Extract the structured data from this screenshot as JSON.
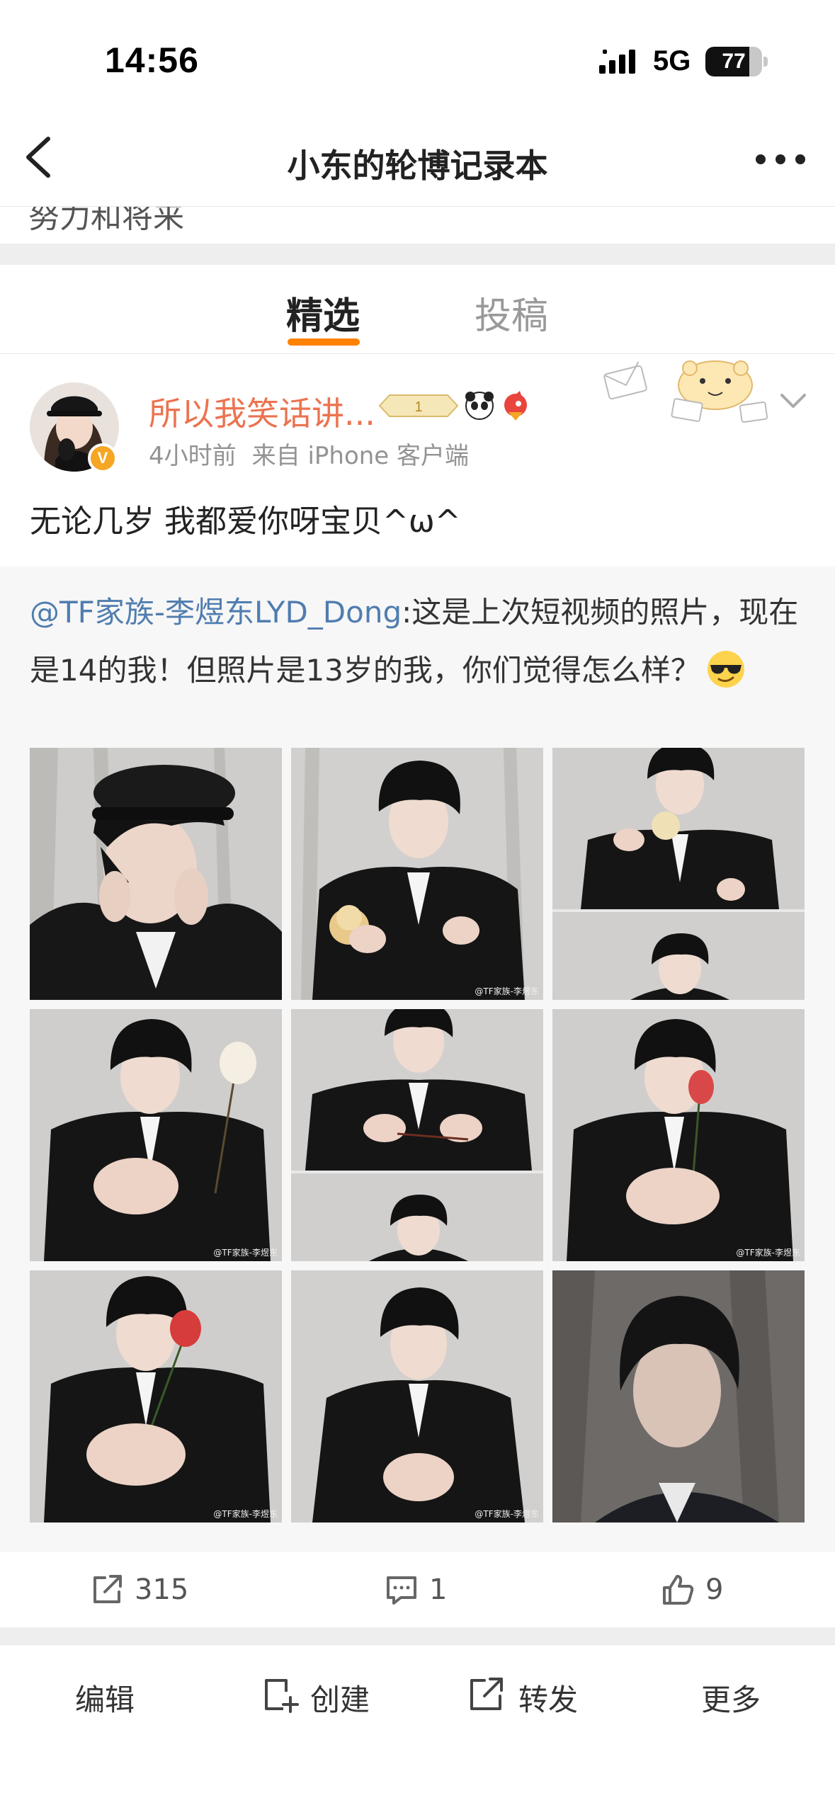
{
  "status_bar": {
    "time": "14:56",
    "network": "5G",
    "battery": "77"
  },
  "nav": {
    "title": "小东的轮博记录本"
  },
  "peek_text": "努力和将来",
  "tabs": [
    {
      "label": "精选",
      "active": true
    },
    {
      "label": "投稿",
      "active": false
    }
  ],
  "post": {
    "username": "所以我笑话讲...",
    "time": "4小时前",
    "source": "来自 iPhone 客户端",
    "text": "无论几岁 我都爱你呀宝贝^ω^",
    "repost": {
      "mention": "@TF家族-李煜东LYD_Dong",
      "text": ":这是上次短视频的照片，现在是14的我！但照片是13岁的我，你们觉得怎么样？"
    },
    "watermark": "@TF家族-李煜东",
    "photo_count": 9
  },
  "actions": {
    "repost_count": "315",
    "comment_count": "1",
    "like_count": "9"
  },
  "toolbar": {
    "edit": "编辑",
    "create": "创建",
    "forward": "转发",
    "more": "更多"
  },
  "colors": {
    "accent": "#ff8200",
    "username": "#eb7350",
    "mention": "#507daf",
    "meta": "#939393",
    "divider": "#eeeeee"
  }
}
